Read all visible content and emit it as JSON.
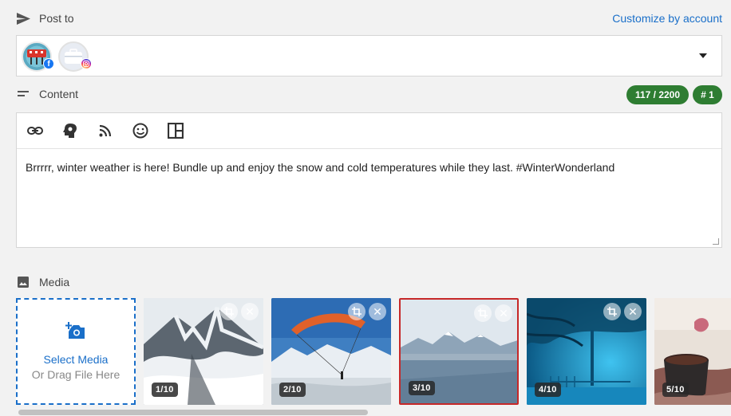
{
  "post_to": {
    "label": "Post to",
    "customize_link": "Customize by account",
    "accounts": [
      {
        "network": "facebook",
        "badge": "f"
      },
      {
        "network": "instagram",
        "badge": ""
      }
    ]
  },
  "content": {
    "label": "Content",
    "char_count": "117 / 2200",
    "post_number": "# 1",
    "post_text": "Brrrrr, winter weather is here! Bundle up and enjoy the snow and cold temperatures while they last. #WinterWonderland",
    "toolbar_icons": [
      "link-icon",
      "idea-icon",
      "rss-icon",
      "emoji-icon",
      "layout-icon"
    ]
  },
  "media": {
    "label": "Media",
    "select_label": "Select Media",
    "drag_label": "Or Drag File Here",
    "items": [
      {
        "counter": "1/10",
        "selected": false
      },
      {
        "counter": "2/10",
        "selected": false
      },
      {
        "counter": "3/10",
        "selected": true
      },
      {
        "counter": "4/10",
        "selected": false
      },
      {
        "counter": "5/10",
        "selected": false
      }
    ]
  },
  "colors": {
    "accent": "#1a6fc9",
    "pill_green": "#2e7d32",
    "selected_border": "#c62828"
  }
}
